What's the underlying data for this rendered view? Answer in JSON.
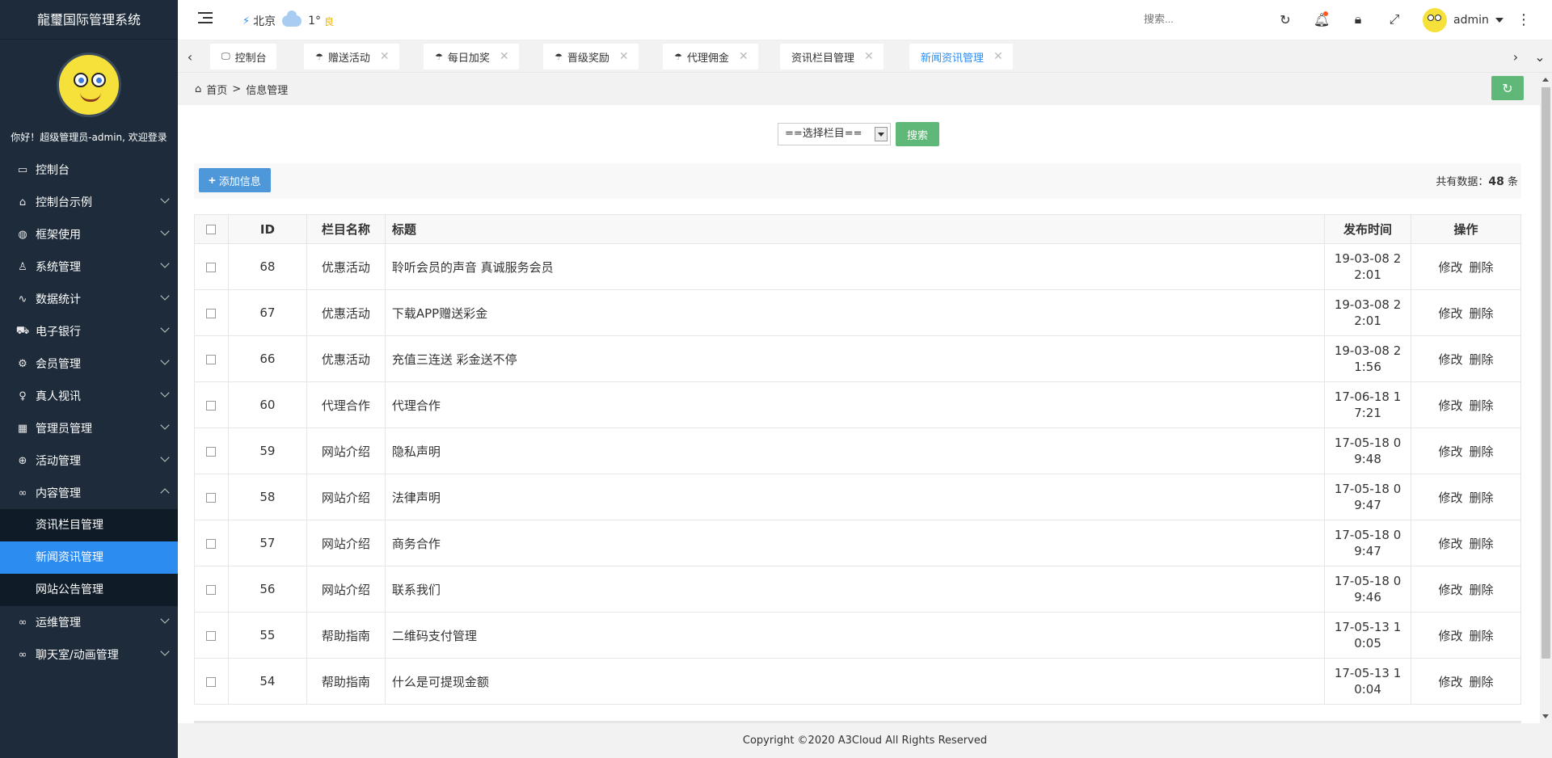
{
  "sidebar": {
    "brand": "龍璽国际管理系统",
    "welcome": "你好！超级管理员-admin, 欢迎登录",
    "items": [
      {
        "label": "控制台",
        "icon": "monitor-icon",
        "glyph": "▭"
      },
      {
        "label": "控制台示例",
        "icon": "home-icon",
        "glyph": "⌂"
      },
      {
        "label": "框架使用",
        "icon": "gauge-icon",
        "glyph": "◍"
      },
      {
        "label": "系统管理",
        "icon": "user-icon",
        "glyph": "♙"
      },
      {
        "label": "数据统计",
        "icon": "pulse-icon",
        "glyph": "∿"
      },
      {
        "label": "电子银行",
        "icon": "car-icon",
        "glyph": "⛟"
      },
      {
        "label": "会员管理",
        "icon": "gear-icon",
        "glyph": "⚙"
      },
      {
        "label": "真人视讯",
        "icon": "female-icon",
        "glyph": "♀"
      },
      {
        "label": "管理员管理",
        "icon": "grid-icon",
        "glyph": "▦"
      },
      {
        "label": "活动管理",
        "icon": "plus-circle-icon",
        "glyph": "⊕"
      },
      {
        "label": "内容管理",
        "icon": "link-icon",
        "glyph": "∞"
      }
    ],
    "sub_items": [
      "资讯栏目管理",
      "新闻资讯管理",
      "网站公告管理"
    ],
    "bottom_items": [
      {
        "label": "运维管理",
        "icon": "link-icon",
        "glyph": "∞"
      },
      {
        "label": "聊天室/动画管理",
        "icon": "link-icon",
        "glyph": "∞"
      }
    ]
  },
  "header": {
    "city": "北京",
    "temperature": "1°",
    "aqi": "良",
    "search_placeholder": "搜索...",
    "username": "admin"
  },
  "tabs": [
    {
      "label": "控制台",
      "icon": "monitor-icon",
      "closable": false
    },
    {
      "label": "赠送活动",
      "icon": "umbrella-icon",
      "closable": true
    },
    {
      "label": "每日加奖",
      "icon": "umbrella-icon",
      "closable": true
    },
    {
      "label": "晋级奖励",
      "icon": "umbrella-icon",
      "closable": true
    },
    {
      "label": "代理佣金",
      "icon": "umbrella-icon",
      "closable": true
    },
    {
      "label": "资讯栏目管理",
      "icon": "",
      "closable": true
    },
    {
      "label": "新闻资讯管理",
      "icon": "",
      "closable": true,
      "active": true
    }
  ],
  "breadcrumb": {
    "home": "首页",
    "separator": ">",
    "current": "信息管理"
  },
  "filter": {
    "select_value": "==选择栏目==",
    "search_button": "搜索"
  },
  "toolbar": {
    "add_button": "添加信息",
    "total_prefix": "共有数据：",
    "total_count": "48",
    "total_suffix": " 条"
  },
  "table": {
    "headers": {
      "id": "ID",
      "category": "栏目名称",
      "title": "标题",
      "time": "发布时间",
      "ops": "操作"
    },
    "rows": [
      {
        "id": "68",
        "category": "优惠活动",
        "title": "聆听会员的声音 真诚服务会员",
        "time1": "19-03-08 2",
        "time2": "2:01"
      },
      {
        "id": "67",
        "category": "优惠活动",
        "title": "下载APP赠送彩金",
        "time1": "19-03-08 2",
        "time2": "2:01"
      },
      {
        "id": "66",
        "category": "优惠活动",
        "title": "充值三连送 彩金送不停",
        "time1": "19-03-08 2",
        "time2": "1:56"
      },
      {
        "id": "60",
        "category": "代理合作",
        "title": "代理合作",
        "time1": "17-06-18 1",
        "time2": "7:21"
      },
      {
        "id": "59",
        "category": "网站介绍",
        "title": "隐私声明",
        "time1": "17-05-18 0",
        "time2": "9:48"
      },
      {
        "id": "58",
        "category": "网站介绍",
        "title": "法律声明",
        "time1": "17-05-18 0",
        "time2": "9:47"
      },
      {
        "id": "57",
        "category": "网站介绍",
        "title": "商务合作",
        "time1": "17-05-18 0",
        "time2": "9:47"
      },
      {
        "id": "56",
        "category": "网站介绍",
        "title": "联系我们",
        "time1": "17-05-18 0",
        "time2": "9:46"
      },
      {
        "id": "55",
        "category": "帮助指南",
        "title": "二维码支付管理",
        "time1": "17-05-13 1",
        "time2": "0:05"
      },
      {
        "id": "54",
        "category": "帮助指南",
        "title": "什么是可提现金额",
        "time1": "17-05-13 1",
        "time2": "0:04"
      }
    ],
    "edit_label": "修改",
    "delete_label": "删除"
  },
  "footer": "Copyright ©2020 A3Cloud All Rights Reserved",
  "colors": {
    "sidebar_bg": "#1d2b3a",
    "active_blue": "#2d8cf0",
    "green": "#5fb878",
    "add_blue": "#4e97d9"
  }
}
